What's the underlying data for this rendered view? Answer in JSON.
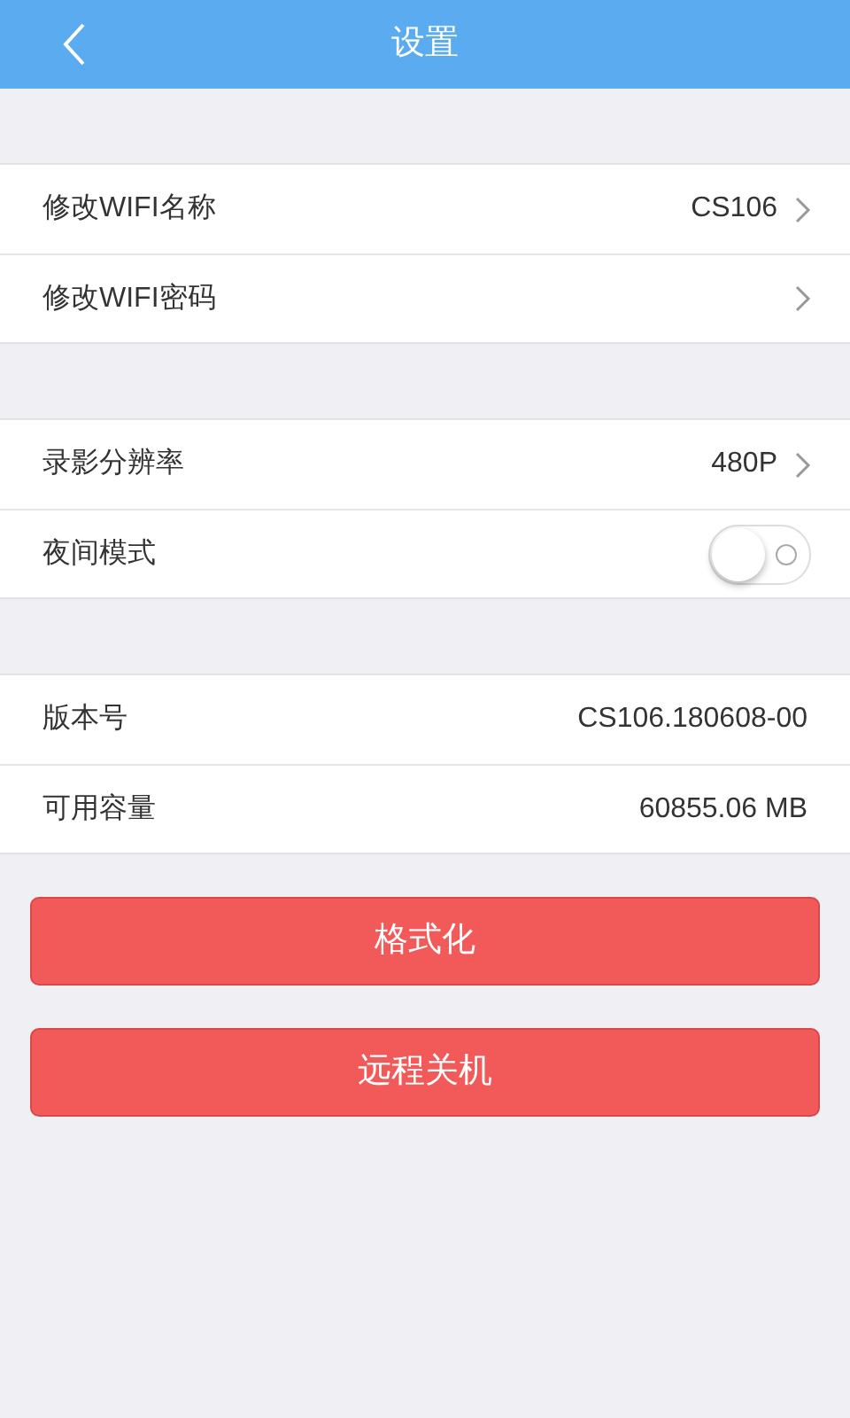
{
  "header": {
    "title": "设置"
  },
  "sections": [
    {
      "rows": [
        {
          "kind": "link",
          "label": "修改WIFI名称",
          "value": "CS106"
        },
        {
          "kind": "link",
          "label": "修改WIFI密码"
        }
      ]
    },
    {
      "rows": [
        {
          "kind": "link",
          "label": "录影分辨率",
          "value": "480P"
        },
        {
          "kind": "toggle",
          "label": "夜间模式",
          "on": false
        }
      ]
    },
    {
      "rows": [
        {
          "kind": "info",
          "label": "版本号",
          "value": "CS106.180608-00"
        },
        {
          "kind": "info",
          "label": "可用容量",
          "value": "60855.06 MB"
        }
      ]
    }
  ],
  "buttons": [
    {
      "label": "格式化"
    },
    {
      "label": "远程关机"
    }
  ]
}
